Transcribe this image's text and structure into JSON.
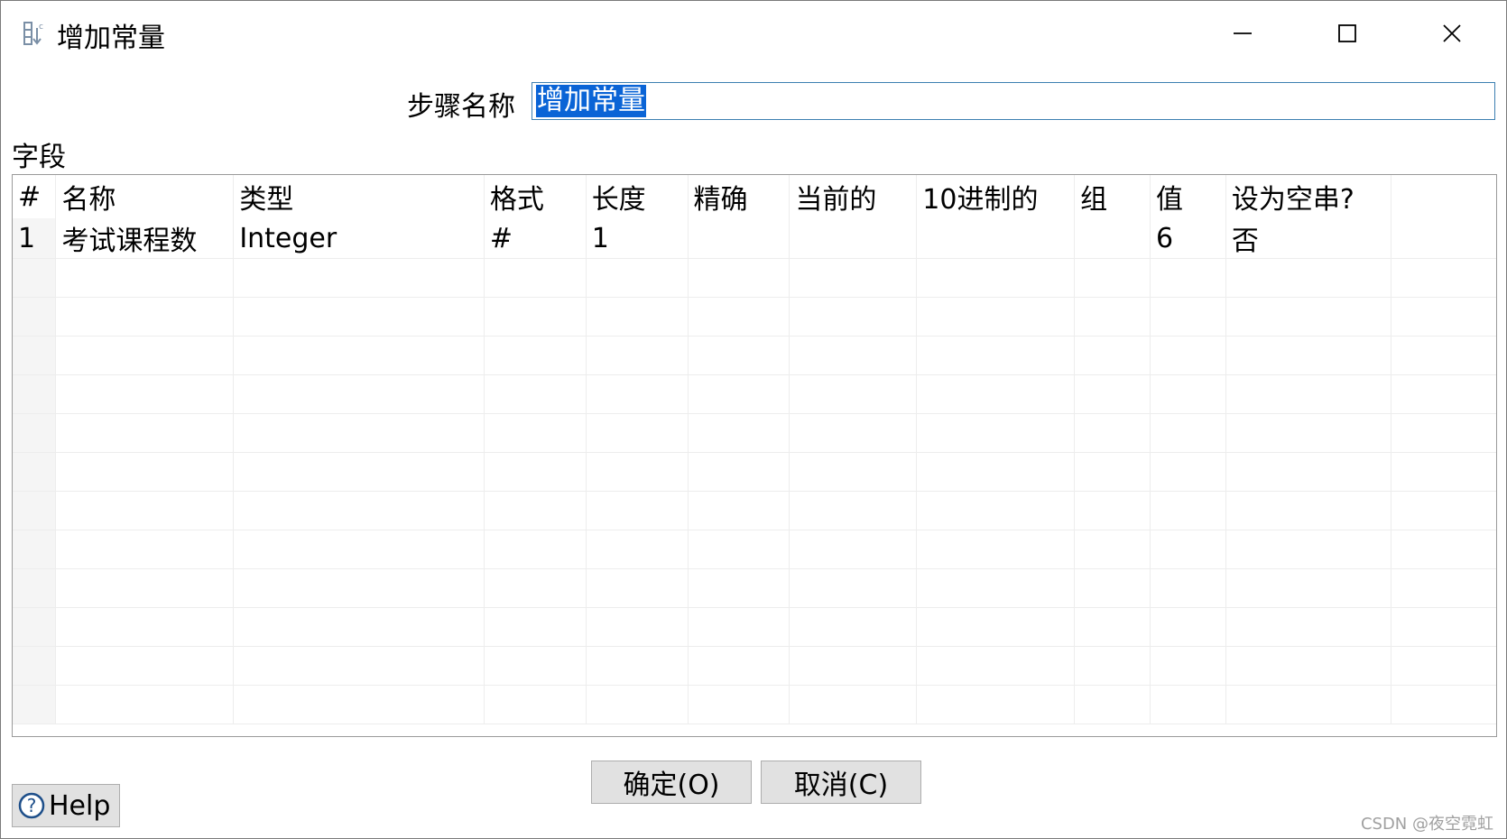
{
  "window": {
    "title": "增加常量",
    "icon": "table-icon",
    "controls": {
      "minimize": "minimize-icon",
      "maximize": "maximize-icon",
      "close": "close-icon"
    }
  },
  "step": {
    "label": "步骤名称",
    "value": "增加常量"
  },
  "fields_label": "字段",
  "table": {
    "headers": [
      "#",
      "名称",
      "类型",
      "格式",
      "长度",
      "精确",
      "当前的",
      "10进制的",
      "组",
      "值",
      "设为空串?"
    ],
    "rows": [
      [
        "1",
        "考试课程数",
        "Integer",
        "#",
        "1",
        "",
        "",
        "",
        "",
        "6",
        "否"
      ]
    ]
  },
  "buttons": {
    "ok": "确定(O)",
    "cancel": "取消(C)",
    "help": "Help"
  },
  "watermark": "CSDN @夜空霓虹",
  "colors": {
    "selection": "#0a64d6",
    "input_border": "#3c7fb1",
    "button_bg": "#e1e1e1"
  }
}
